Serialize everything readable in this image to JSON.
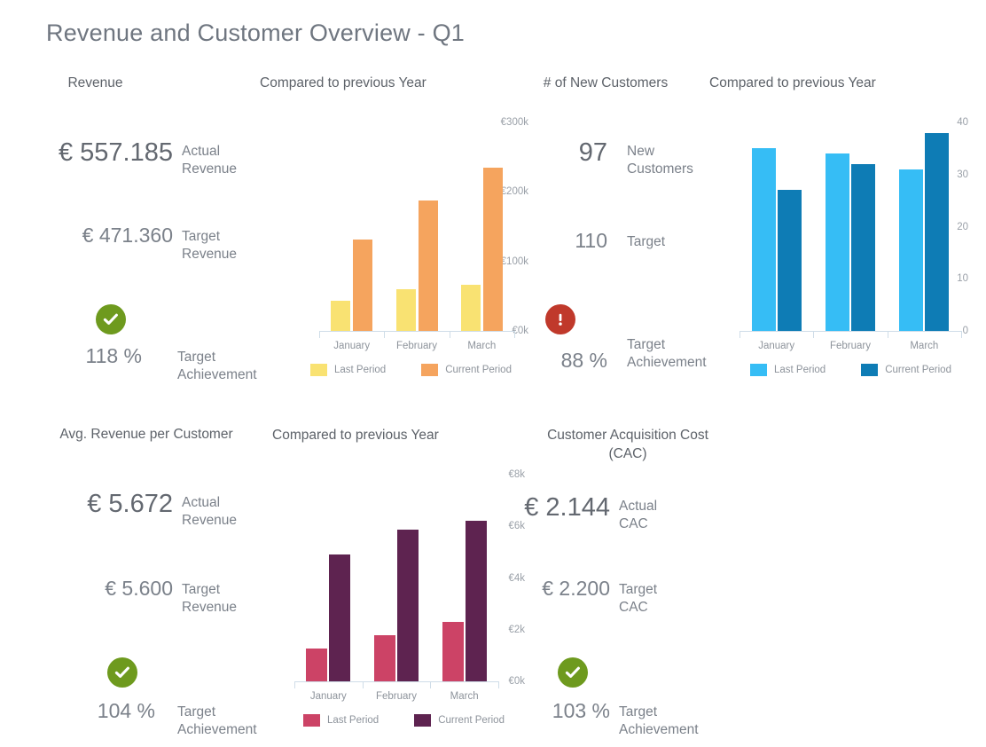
{
  "title": "Revenue and Customer Overview - Q1",
  "colors": {
    "title_text": "#6f7680",
    "body_text": "#7b818a",
    "value_text": "#6b6f76",
    "axis": "#cfdde8",
    "tick_text": "#9aa0a8",
    "success": "#6e9a1e",
    "alert": "#c0392b",
    "revenue_last": "#f9e272",
    "revenue_current": "#f5a45e",
    "customers_last": "#36bdf5",
    "customers_current": "#0e7cb5",
    "arpc_last": "#cc4366",
    "arpc_current": "#5e2350"
  },
  "panels": {
    "revenue_kpi": {
      "title": "Revenue",
      "rows": [
        {
          "value": "€ 557.185",
          "label": "Actual\nRevenue"
        },
        {
          "value": "€ 471.360",
          "label": "Target\nRevenue"
        },
        {
          "value": "118 %",
          "label": "Target\nAchievement"
        }
      ],
      "status": "check-icon"
    },
    "customers_kpi": {
      "title": "# of New Customers",
      "rows": [
        {
          "value": "97",
          "label": "New\nCustomers"
        },
        {
          "value": "110",
          "label": "Target"
        },
        {
          "value": "88 %",
          "label": "Target\nAchievement"
        }
      ],
      "status": "alert-icon"
    },
    "arpc_kpi": {
      "title": "Avg. Revenue per Customer",
      "rows": [
        {
          "value": "€ 5.672",
          "label": "Actual\nRevenue"
        },
        {
          "value": "€ 5.600",
          "label": "Target\nRevenue"
        },
        {
          "value": "104 %",
          "label": "Target\nAchievement"
        }
      ],
      "status": "check-icon"
    },
    "cac_kpi": {
      "title": "Customer Acquisition Cost (CAC)",
      "rows": [
        {
          "value": "€ 2.144",
          "label": "Actual\nCAC"
        },
        {
          "value": "€ 2.200",
          "label": "Target\nCAC"
        },
        {
          "value": "103 %",
          "label": "Target\nAchievement"
        }
      ],
      "status": "check-icon"
    },
    "revenue_chart_title": "Compared to previous Year",
    "customers_chart_title": "Compared to previous Year",
    "arpc_chart_title": "Compared to previous Year"
  },
  "chart_data": [
    {
      "id": "revenue-comparison",
      "type": "bar",
      "title": "Compared to previous Year",
      "xlabel": "",
      "ylabel": "",
      "categories": [
        "January",
        "February",
        "March"
      ],
      "series": [
        {
          "name": "Last Period",
          "color": "#f9e272",
          "values": [
            43000,
            60000,
            67000
          ]
        },
        {
          "name": "Current Period",
          "color": "#f5a45e",
          "values": [
            132000,
            188000,
            235000
          ]
        }
      ],
      "ylim": [
        0,
        300000
      ],
      "yticks": [
        0,
        100000,
        200000,
        300000
      ],
      "ytick_labels": [
        "€0k",
        "€100k",
        "€200k",
        "€300k"
      ],
      "grid": false,
      "legend": "bottom"
    },
    {
      "id": "customers-comparison",
      "type": "bar",
      "title": "Compared to previous Year",
      "xlabel": "",
      "ylabel": "",
      "categories": [
        "January",
        "February",
        "March"
      ],
      "series": [
        {
          "name": "Last Period",
          "color": "#36bdf5",
          "values": [
            35,
            34,
            31
          ]
        },
        {
          "name": "Current Period",
          "color": "#0e7cb5",
          "values": [
            27,
            32,
            38
          ]
        }
      ],
      "ylim": [
        0,
        40
      ],
      "yticks": [
        0,
        10,
        20,
        30,
        40
      ],
      "ytick_labels": [
        "0",
        "10",
        "20",
        "30",
        "40"
      ],
      "grid": false,
      "legend": "bottom"
    },
    {
      "id": "arpc-comparison",
      "type": "bar",
      "title": "Compared to previous Year",
      "xlabel": "",
      "ylabel": "",
      "categories": [
        "January",
        "February",
        "March"
      ],
      "series": [
        {
          "name": "Last Period",
          "color": "#cc4366",
          "values": [
            1270,
            1790,
            2290
          ]
        },
        {
          "name": "Current Period",
          "color": "#5e2350",
          "values": [
            4900,
            5860,
            6200
          ]
        }
      ],
      "ylim": [
        0,
        8000
      ],
      "yticks": [
        0,
        2000,
        4000,
        6000,
        8000
      ],
      "ytick_labels": [
        "€0k",
        "€2k",
        "€4k",
        "€6k",
        "€8k"
      ],
      "grid": false,
      "legend": "bottom"
    }
  ]
}
